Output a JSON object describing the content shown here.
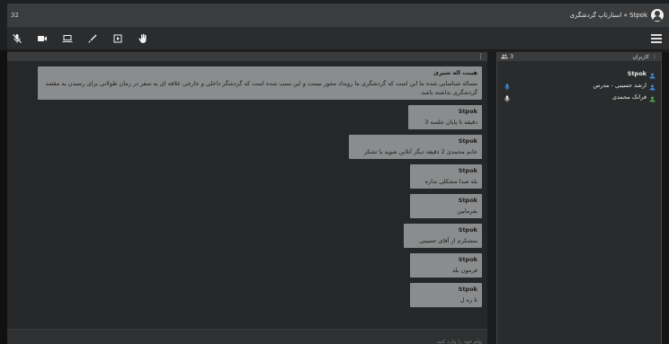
{
  "window": {
    "left_label": "32",
    "title": "Stpok » استارتاپ گردشگری"
  },
  "toolbar": {
    "icons": [
      "mic-off-icon",
      "camera-icon",
      "screen-share-icon",
      "pen-icon",
      "play-icon",
      "hand-icon"
    ],
    "menu_icon": "hamburger-menu-icon"
  },
  "chat": {
    "input_placeholder": "پیام خود را وارد کنید",
    "messages": [
      {
        "sender": "هیبت اله شیری",
        "text": "مساله شناسایی شده ما این است که گردشگری ما رویداد محور نیست و این سبب شده است که گردشگر داخلی و خارجی علاقه ای به سفر در زمان طولانی برای رسیدن به مقصد گردشگری نداشته باشد."
      },
      {
        "sender": "Stpok",
        "text": "دقیقه تا پایان جلسه 3"
      },
      {
        "sender": "Stpok",
        "text": "خانم محمدی 2 دقیقه دیگر آنلاین شوید یا تشکر"
      },
      {
        "sender": "Stpok",
        "text": "بله صدا مشکلی نداره"
      },
      {
        "sender": "Stpok",
        "text": "بفرمایین"
      },
      {
        "sender": "Stpok",
        "text": "متشکرم از آقای حسینی"
      },
      {
        "sender": "Stpok",
        "text": "فرمون بله"
      },
      {
        "sender": "Stpok",
        "text": "تا زه ل"
      }
    ]
  },
  "users": {
    "count": "3",
    "header_label": "کاربران",
    "list": [
      {
        "name": "Stpok",
        "bold": true,
        "icon_color": "#3d8fe6",
        "mic": ""
      },
      {
        "name": "ارشد حسینی - مدرس",
        "bold": false,
        "icon_color": "#3d8fe6",
        "mic": "mic-active-icon"
      },
      {
        "name": "فرانک محمدی",
        "bold": false,
        "icon_color": "#4caf50",
        "mic": "mic-icon"
      }
    ]
  },
  "colors": {
    "accent_blue": "#3d8fe6",
    "accent_green": "#4caf50",
    "bubble": "#8b8c8d"
  }
}
